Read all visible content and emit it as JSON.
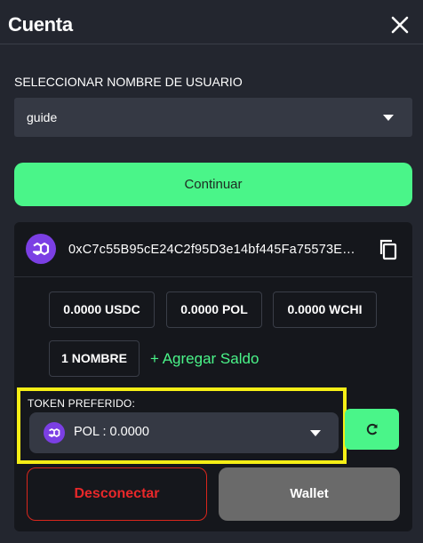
{
  "header": {
    "title": "Cuenta"
  },
  "username": {
    "label": "SELECCIONAR NOMBRE DE USUARIO",
    "selected": "guide"
  },
  "continue_label": "Continuar",
  "wallet": {
    "address": "0xC7c55B95cE24C2f95D3e14bf445Fa75573E…",
    "balances": [
      "0.0000 USDC",
      "0.0000 POL",
      "0.0000 WCHI"
    ],
    "names_count": "1 NOMBRE",
    "add_balance_label": "+ Agregar Saldo",
    "preferred_token": {
      "label": "TOKEN PREFERIDO:",
      "selected": "POL : 0.0000"
    },
    "disconnect_label": "Desconectar",
    "wallet_label": "Wallet"
  },
  "colors": {
    "accent_green": "#4af589",
    "highlight_yellow": "#f5ee16",
    "danger_red": "#e8282a",
    "polygon_purple": "#7b3fe4"
  },
  "icons": [
    "close-icon",
    "chevron-down-icon",
    "polygon-icon",
    "copy-icon",
    "refresh-icon"
  ]
}
